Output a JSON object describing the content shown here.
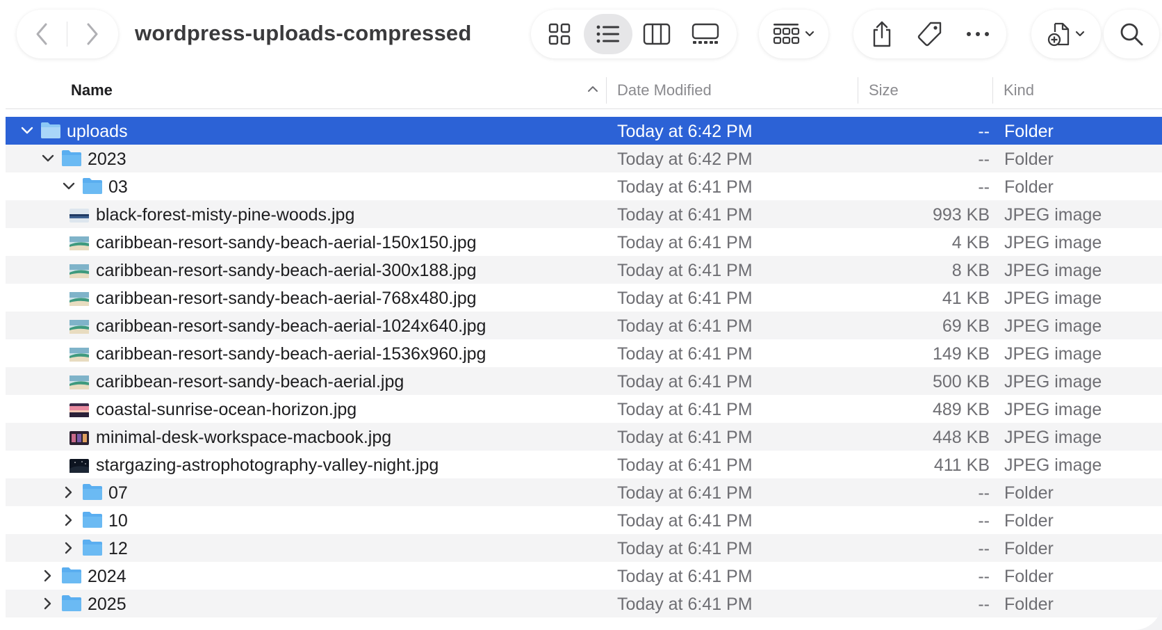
{
  "window": {
    "title": "wordpress-uploads-compressed"
  },
  "toolbar": {
    "icons": [
      "chevron-left-icon",
      "chevron-right-icon",
      "icon-view-icon",
      "list-view-icon",
      "column-view-icon",
      "gallery-view-icon",
      "group-by-icon",
      "share-icon",
      "tag-icon",
      "more-icon",
      "new-file-icon",
      "search-icon"
    ],
    "active_view": "list"
  },
  "columns": {
    "name": "Name",
    "date": "Date Modified",
    "size": "Size",
    "kind": "Kind"
  },
  "rows": [
    {
      "name": "uploads",
      "date": "Today at 6:42 PM",
      "size": "--",
      "kind": "Folder",
      "type": "folder",
      "level": 0,
      "expanded": true,
      "selected": true
    },
    {
      "name": "2023",
      "date": "Today at 6:42 PM",
      "size": "--",
      "kind": "Folder",
      "type": "folder",
      "level": 1,
      "expanded": true
    },
    {
      "name": "03",
      "date": "Today at 6:41 PM",
      "size": "--",
      "kind": "Folder",
      "type": "folder",
      "level": 2,
      "expanded": true
    },
    {
      "name": "black-forest-misty-pine-woods.jpg",
      "date": "Today at 6:41 PM",
      "size": "993 KB",
      "kind": "JPEG image",
      "type": "image",
      "thumb": "forest",
      "level": 3
    },
    {
      "name": "caribbean-resort-sandy-beach-aerial-150x150.jpg",
      "date": "Today at 6:41 PM",
      "size": "4 KB",
      "kind": "JPEG image",
      "type": "image",
      "thumb": "beach",
      "level": 3
    },
    {
      "name": "caribbean-resort-sandy-beach-aerial-300x188.jpg",
      "date": "Today at 6:41 PM",
      "size": "8 KB",
      "kind": "JPEG image",
      "type": "image",
      "thumb": "beach",
      "level": 3
    },
    {
      "name": "caribbean-resort-sandy-beach-aerial-768x480.jpg",
      "date": "Today at 6:41 PM",
      "size": "41 KB",
      "kind": "JPEG image",
      "type": "image",
      "thumb": "beach",
      "level": 3
    },
    {
      "name": "caribbean-resort-sandy-beach-aerial-1024x640.jpg",
      "date": "Today at 6:41 PM",
      "size": "69 KB",
      "kind": "JPEG image",
      "type": "image",
      "thumb": "beach",
      "level": 3
    },
    {
      "name": "caribbean-resort-sandy-beach-aerial-1536x960.jpg",
      "date": "Today at 6:41 PM",
      "size": "149 KB",
      "kind": "JPEG image",
      "type": "image",
      "thumb": "beach",
      "level": 3
    },
    {
      "name": "caribbean-resort-sandy-beach-aerial.jpg",
      "date": "Today at 6:41 PM",
      "size": "500 KB",
      "kind": "JPEG image",
      "type": "image",
      "thumb": "beach",
      "level": 3
    },
    {
      "name": "coastal-sunrise-ocean-horizon.jpg",
      "date": "Today at 6:41 PM",
      "size": "489 KB",
      "kind": "JPEG image",
      "type": "image",
      "thumb": "sunrise",
      "level": 3
    },
    {
      "name": "minimal-desk-workspace-macbook.jpg",
      "date": "Today at 6:41 PM",
      "size": "448 KB",
      "kind": "JPEG image",
      "type": "image",
      "thumb": "desk",
      "level": 3
    },
    {
      "name": "stargazing-astrophotography-valley-night.jpg",
      "date": "Today at 6:41 PM",
      "size": "411 KB",
      "kind": "JPEG image",
      "type": "image",
      "thumb": "night",
      "level": 3
    },
    {
      "name": "07",
      "date": "Today at 6:41 PM",
      "size": "--",
      "kind": "Folder",
      "type": "folder",
      "level": 2,
      "expanded": false
    },
    {
      "name": "10",
      "date": "Today at 6:41 PM",
      "size": "--",
      "kind": "Folder",
      "type": "folder",
      "level": 2,
      "expanded": false
    },
    {
      "name": "12",
      "date": "Today at 6:41 PM",
      "size": "--",
      "kind": "Folder",
      "type": "folder",
      "level": 2,
      "expanded": false
    },
    {
      "name": "2024",
      "date": "Today at 6:41 PM",
      "size": "--",
      "kind": "Folder",
      "type": "folder",
      "level": 1,
      "expanded": false
    },
    {
      "name": "2025",
      "date": "Today at 6:41 PM",
      "size": "--",
      "kind": "Folder",
      "type": "folder",
      "level": 1,
      "expanded": false
    }
  ],
  "colors": {
    "selection": "#2c62d6",
    "folder": "#5aaef0",
    "stripe": "#f4f4f5",
    "secondary_text": "#6e6e73"
  }
}
